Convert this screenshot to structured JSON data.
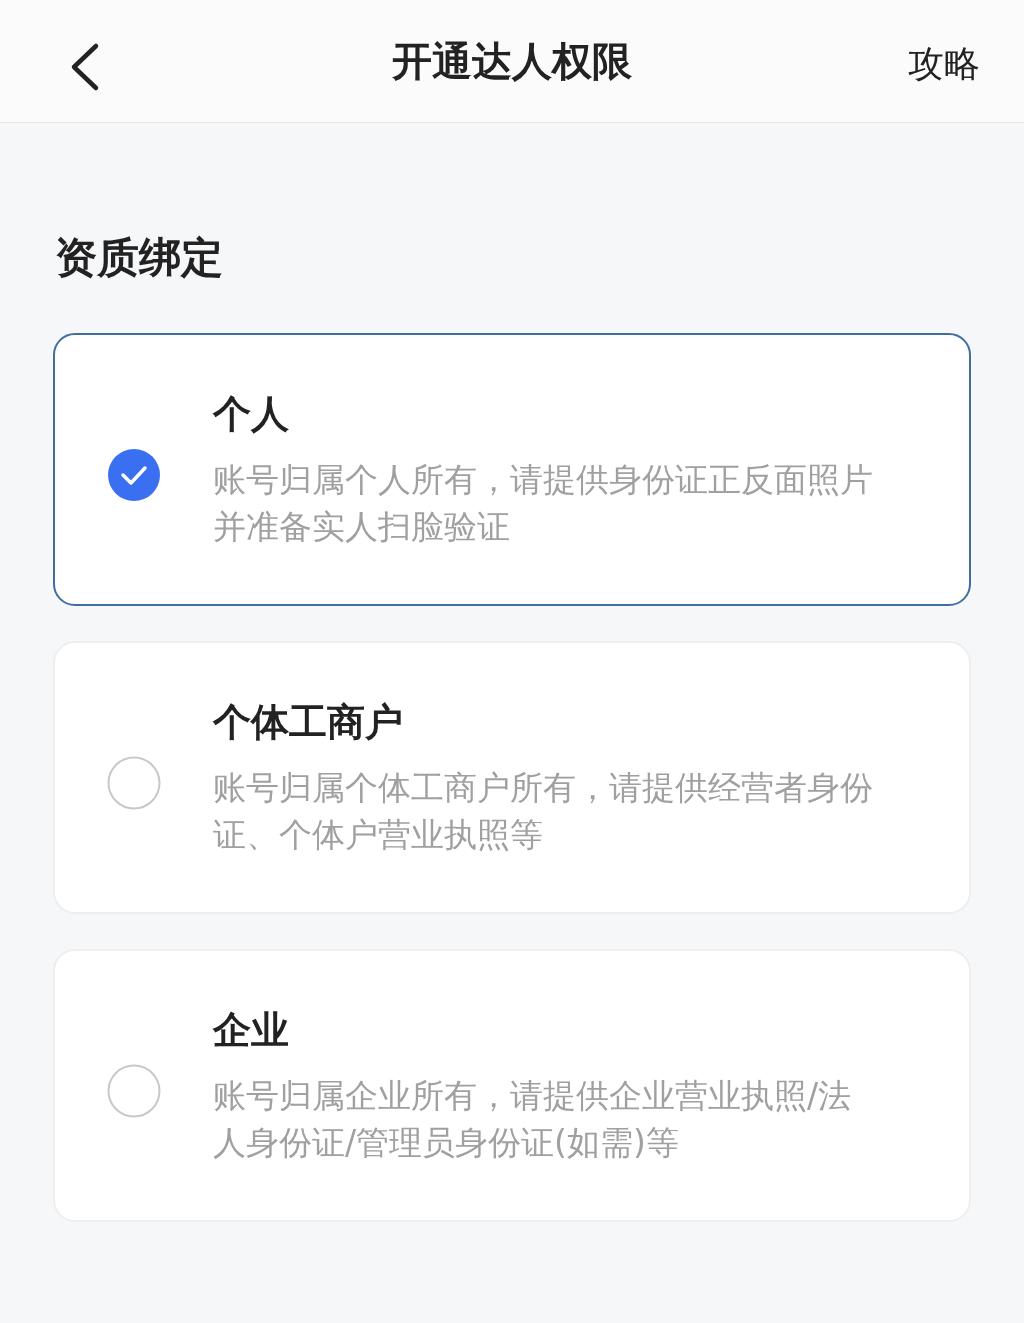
{
  "header": {
    "title": "开通达人权限",
    "action": "攻略"
  },
  "section_title": "资质绑定",
  "options": [
    {
      "title": "个人",
      "description": "账号归属个人所有，请提供身份证正反面照片并准备实人扫脸验证",
      "selected": true
    },
    {
      "title": "个体工商户",
      "description": "账号归属个体工商户所有，请提供经营者身份证、个体户营业执照等",
      "selected": false
    },
    {
      "title": "企业",
      "description": "账号归属企业所有，请提供企业营业执照/法人身份证/管理员身份证(如需)等",
      "selected": false
    }
  ]
}
